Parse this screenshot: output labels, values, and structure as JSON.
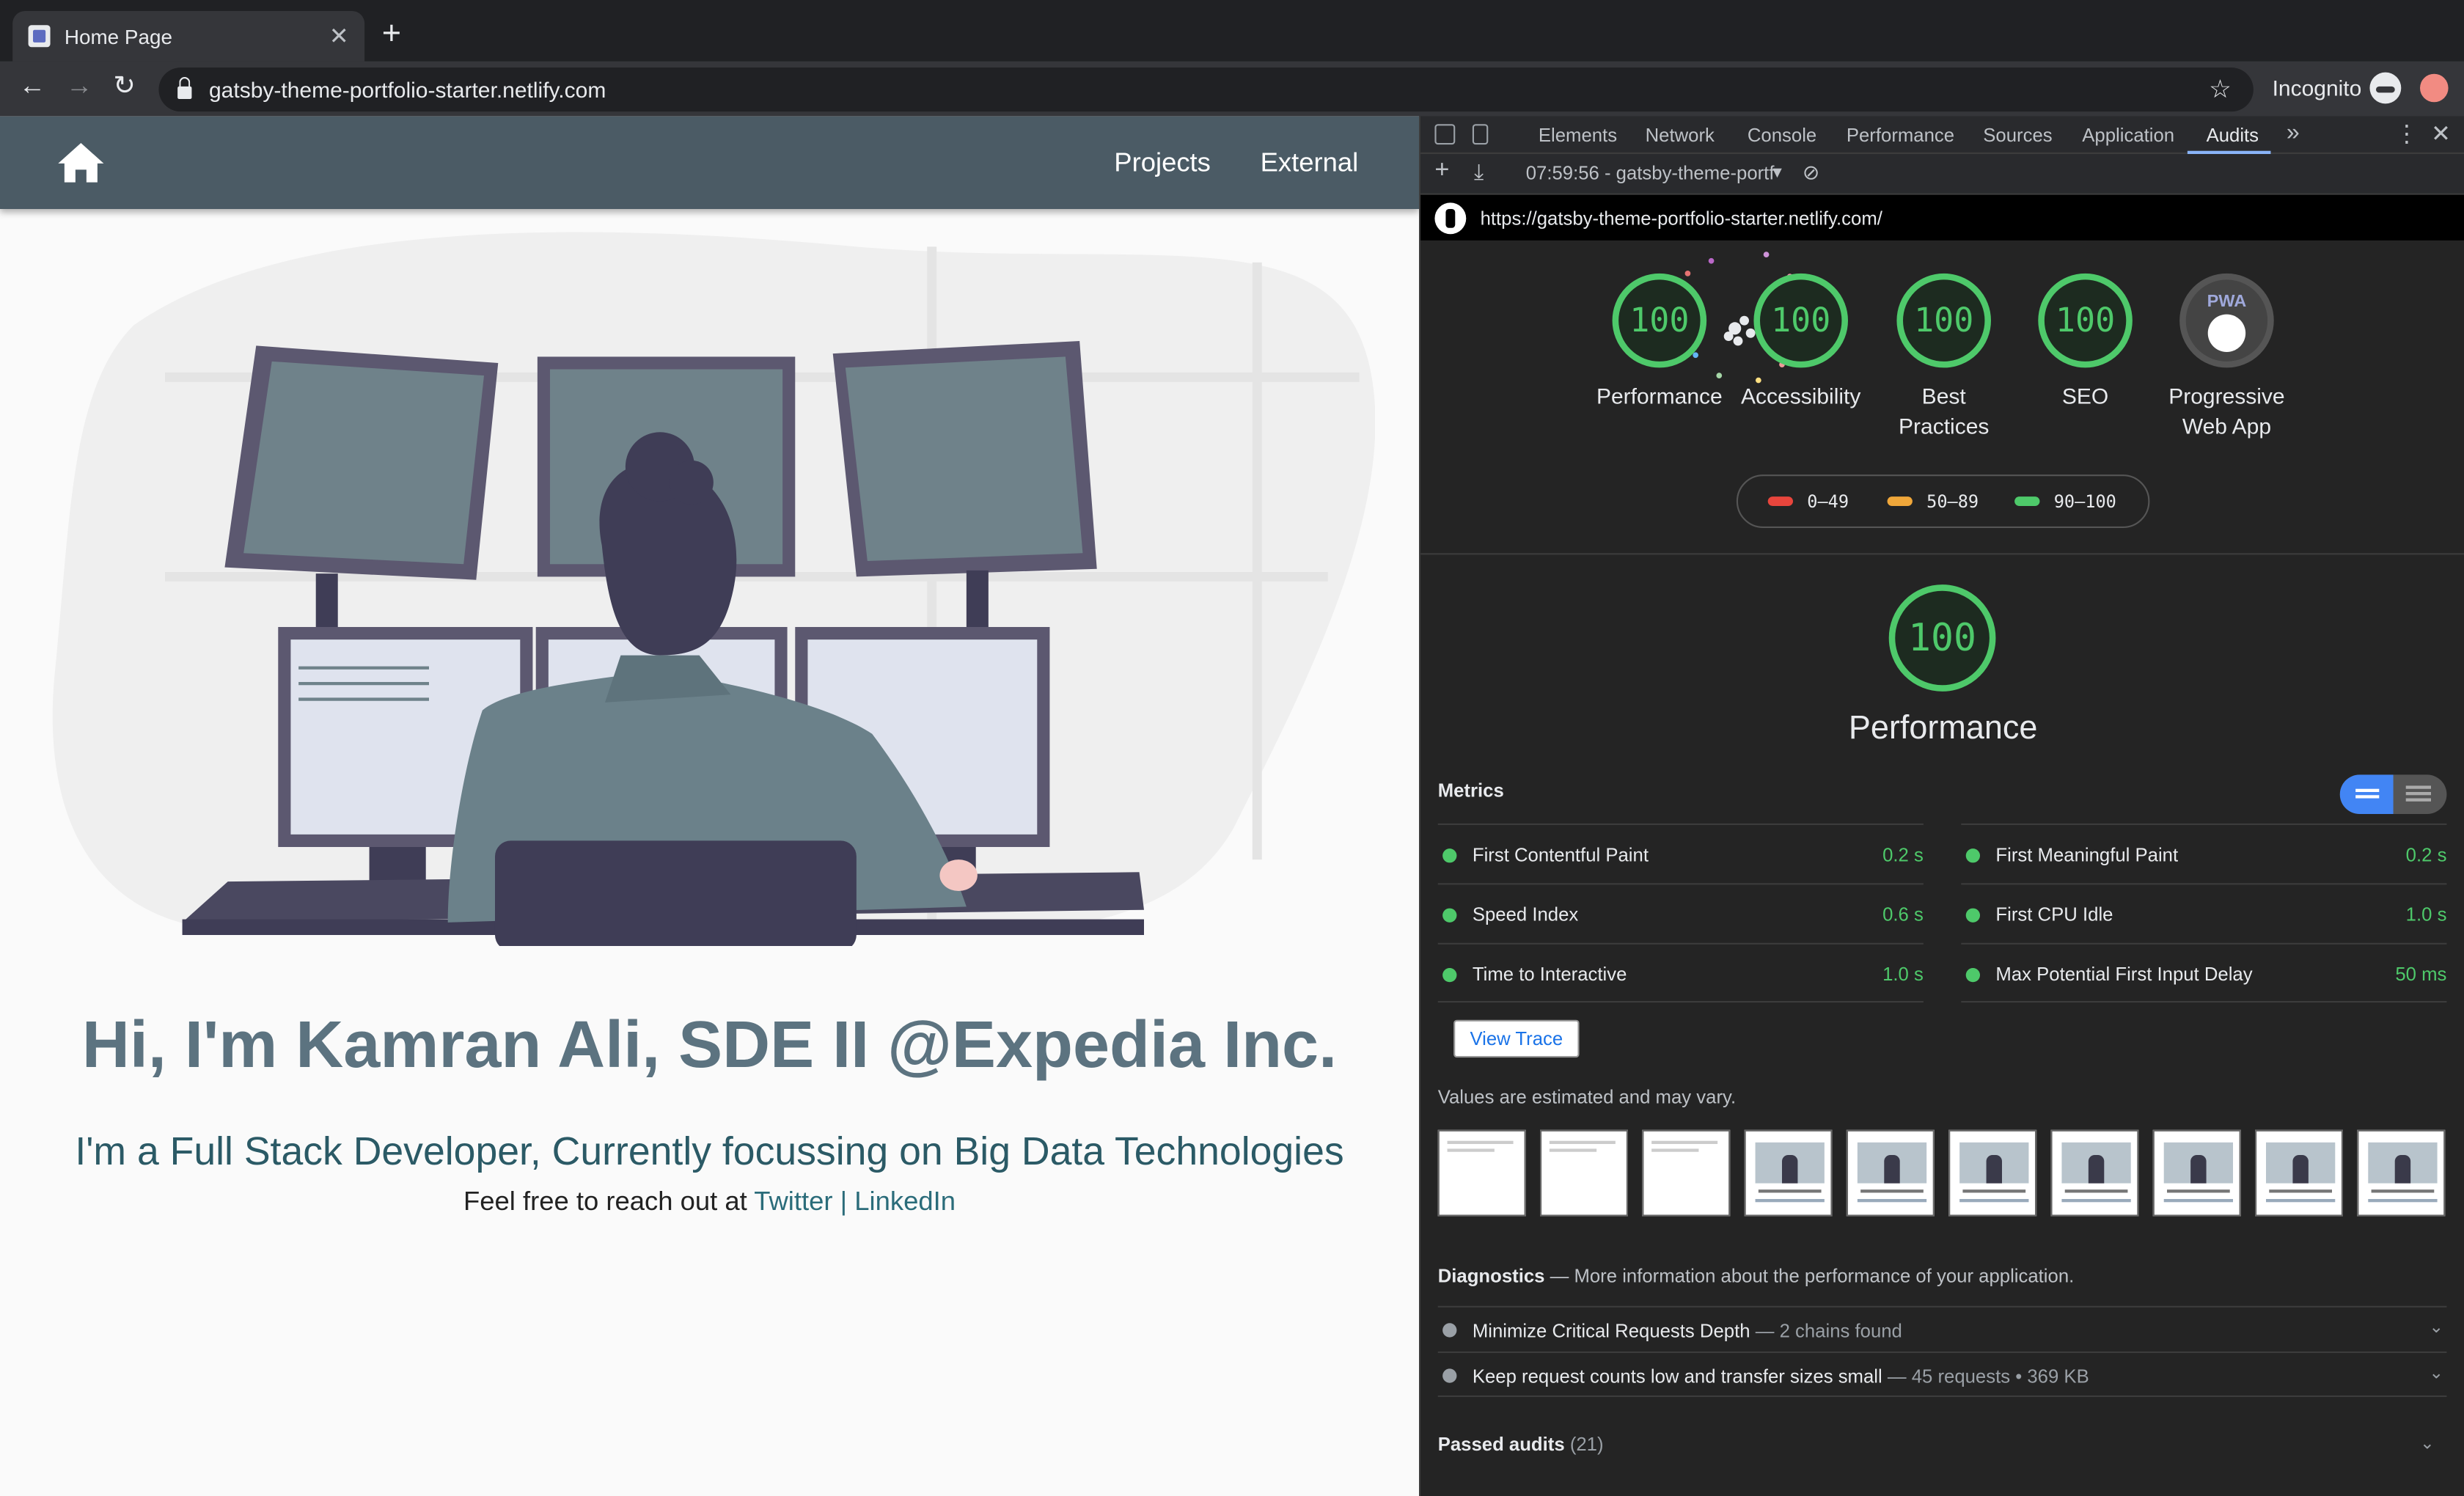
{
  "browser": {
    "tab_title": "Home Page",
    "tab_close": "✕",
    "new_tab": "+",
    "url": "gatsby-theme-portfolio-starter.netlify.com",
    "incognito_label": "Incognito"
  },
  "site": {
    "nav": [
      "Projects",
      "External"
    ],
    "headline": "Hi, I'm Kamran Ali, SDE II @Expedia Inc.",
    "subheadline": "I'm a Full Stack Developer, Currently focussing on Big Data Technologies",
    "reach_prefix": "Feel free to reach out at ",
    "link_twitter": "Twitter",
    "link_sep": " | ",
    "link_linkedin": "LinkedIn"
  },
  "devtools": {
    "tabs": [
      "Elements",
      "Network",
      "Console",
      "Performance",
      "Sources",
      "Application",
      "Audits"
    ],
    "active_tab": "Audits",
    "more": "»",
    "report_select": "07:59:56 - gatsby-theme-portf",
    "audited_url": "https://gatsby-theme-portfolio-starter.netlify.com/",
    "gauges": [
      {
        "label": "Performance",
        "score": "100"
      },
      {
        "label": "Accessibility",
        "score": "100"
      },
      {
        "label": "Best Practices",
        "score": "100"
      },
      {
        "label": "SEO",
        "score": "100"
      },
      {
        "label": "Progressive Web App",
        "score": "PWA"
      }
    ],
    "legend": [
      {
        "range": "0–49",
        "color": "#e8453c"
      },
      {
        "range": "50–89",
        "color": "#f0a73a"
      },
      {
        "range": "90–100",
        "color": "#4ec96a"
      }
    ],
    "category_score": "100",
    "category_title": "Performance",
    "metrics_heading": "Metrics",
    "metrics": [
      {
        "name": "First Contentful Paint",
        "value": "0.2 s"
      },
      {
        "name": "First Meaningful Paint",
        "value": "0.2 s"
      },
      {
        "name": "Speed Index",
        "value": "0.6 s"
      },
      {
        "name": "First CPU Idle",
        "value": "1.0 s"
      },
      {
        "name": "Time to Interactive",
        "value": "1.0 s"
      },
      {
        "name": "Max Potential First Input Delay",
        "value": "50 ms"
      }
    ],
    "view_trace": "View Trace",
    "estimate_note": "Values are estimated and may vary.",
    "diagnostics_title": "Diagnostics",
    "diagnostics_desc": " — More information about the performance of your application.",
    "diagnostics": [
      {
        "name": "Minimize Critical Requests Depth",
        "summary": "  — 2 chains found"
      },
      {
        "name": "Keep request counts low and transfer sizes small",
        "summary": "  — 45 requests • 369 KB"
      }
    ],
    "passed_label": "Passed audits",
    "passed_count": "(21)",
    "pass_color": "#4ec96a"
  }
}
